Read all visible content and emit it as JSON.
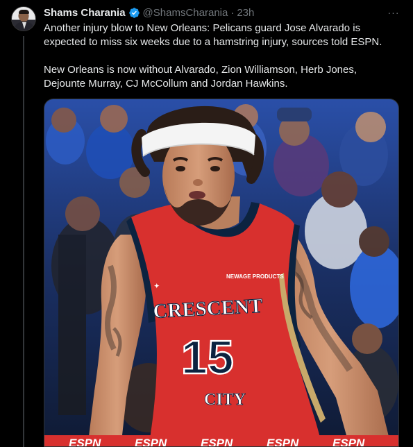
{
  "tweet": {
    "author_name": "Shams Charania",
    "handle": "@ShamsCharania",
    "separator": "·",
    "time": "23h",
    "more_label": "···",
    "paragraphs": [
      "Another injury blow to New Orleans: Pelicans guard Jose Alvarado is expected to miss six weeks due to a hamstring injury, sources told ESPN.",
      "New Orleans is now without Alvarado, Zion Williamson, Herb Jones, Dejounte Murray, CJ McCollum and Jordan Hawkins."
    ],
    "photo": {
      "jersey_sponsor": "NEWAGE PRODUCTS",
      "jersey_text_top": "CRESCENT",
      "jersey_number": "15",
      "jersey_text_bottom": "CITY",
      "banner_text": "ESPN"
    }
  },
  "colors": {
    "background": "#000000",
    "text": "#e7e9ea",
    "muted": "#71767b",
    "verified": "#1d9bf0",
    "jersey_red": "#d8302e",
    "jersey_navy": "#0c2340",
    "jersey_gold": "#c8a96a"
  },
  "icons": {
    "verified": "verified-badge-icon",
    "more": "more-options-icon"
  }
}
